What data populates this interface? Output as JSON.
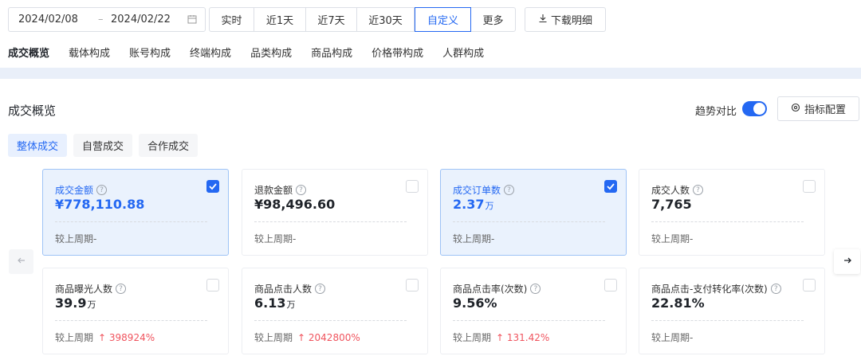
{
  "date_range": {
    "start": "2024/02/08",
    "separator": "–",
    "end": "2024/02/22"
  },
  "periods": [
    {
      "label": "实时",
      "width": 56
    },
    {
      "label": "近1天",
      "width": 65
    },
    {
      "label": "近7天",
      "width": 64
    },
    {
      "label": "近30天",
      "width": 72
    },
    {
      "label": "自定义",
      "width": 71,
      "active": true
    },
    {
      "label": "更多",
      "width": 55
    }
  ],
  "download_label": "下载明细",
  "nav_tabs": [
    "成交概览",
    "载体构成",
    "账号构成",
    "终端构成",
    "品类构成",
    "商品构成",
    "价格带构成",
    "人群构成"
  ],
  "section_title": "成交概览",
  "trend_label": "趋势对比",
  "trend_enabled": true,
  "metric_config_label": "指标配置",
  "sub_tabs": [
    {
      "label": "整体成交",
      "active": true
    },
    {
      "label": "自营成交"
    },
    {
      "label": "合作成交"
    }
  ],
  "cards": [
    {
      "name": "成交金额",
      "value": "¥778,110.88",
      "unit": "",
      "compare_label": "较上周期",
      "compare_value": "-",
      "up": false,
      "selected": true
    },
    {
      "name": "退款金额",
      "value": "¥98,496.60",
      "unit": "",
      "compare_label": "较上周期",
      "compare_value": "-",
      "up": false,
      "selected": false
    },
    {
      "name": "成交订单数",
      "value": "2.37",
      "unit": "万",
      "compare_label": "较上周期",
      "compare_value": "-",
      "up": false,
      "selected": true
    },
    {
      "name": "成交人数",
      "value": "7,765",
      "unit": "",
      "compare_label": "较上周期",
      "compare_value": "-",
      "up": false,
      "selected": false
    },
    {
      "name": "商品曝光人数",
      "value": "39.9",
      "unit": "万",
      "compare_label": "较上周期",
      "compare_value": "398924%",
      "up": true,
      "selected": false
    },
    {
      "name": "商品点击人数",
      "value": "6.13",
      "unit": "万",
      "compare_label": "较上周期",
      "compare_value": "2042800%",
      "up": true,
      "selected": false
    },
    {
      "name": "商品点击率(次数)",
      "value": "9.56%",
      "unit": "",
      "compare_label": "较上周期",
      "compare_value": "131.42%",
      "up": true,
      "selected": false
    },
    {
      "name": "商品点击-支付转化率(次数)",
      "value": "22.81%",
      "unit": "",
      "compare_label": "较上周期",
      "compare_value": "-",
      "up": false,
      "selected": false
    }
  ],
  "colors": {
    "accent": "#2468f2",
    "up": "#f0545e"
  }
}
